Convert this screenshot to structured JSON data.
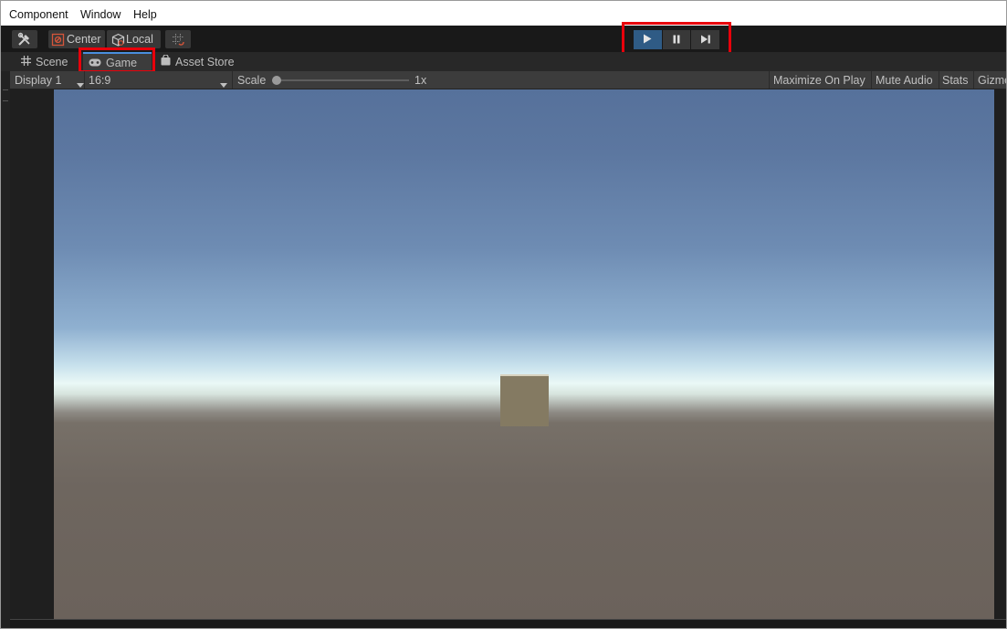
{
  "menu": {
    "items": [
      "Component",
      "Window",
      "Help"
    ]
  },
  "toolbar": {
    "pivot_label": "Center",
    "space_label": "Local",
    "accent_color": "#e8000b",
    "play_active_color": "#2f5b85"
  },
  "tabs": [
    {
      "label": "Scene",
      "icon": "grid-icon"
    },
    {
      "label": "Game",
      "icon": "gamepad-icon",
      "active": true
    },
    {
      "label": "Asset Store",
      "icon": "shopping-bag-icon"
    }
  ],
  "game_controls": {
    "display": "Display 1",
    "aspect": "16:9",
    "scale_label": "Scale",
    "scale_value": "1x",
    "scale_slider_level": 0,
    "maximize_on_play": "Maximize On Play",
    "mute_audio": "Mute Audio",
    "stats": "Stats",
    "gizmos": "Gizmos"
  }
}
